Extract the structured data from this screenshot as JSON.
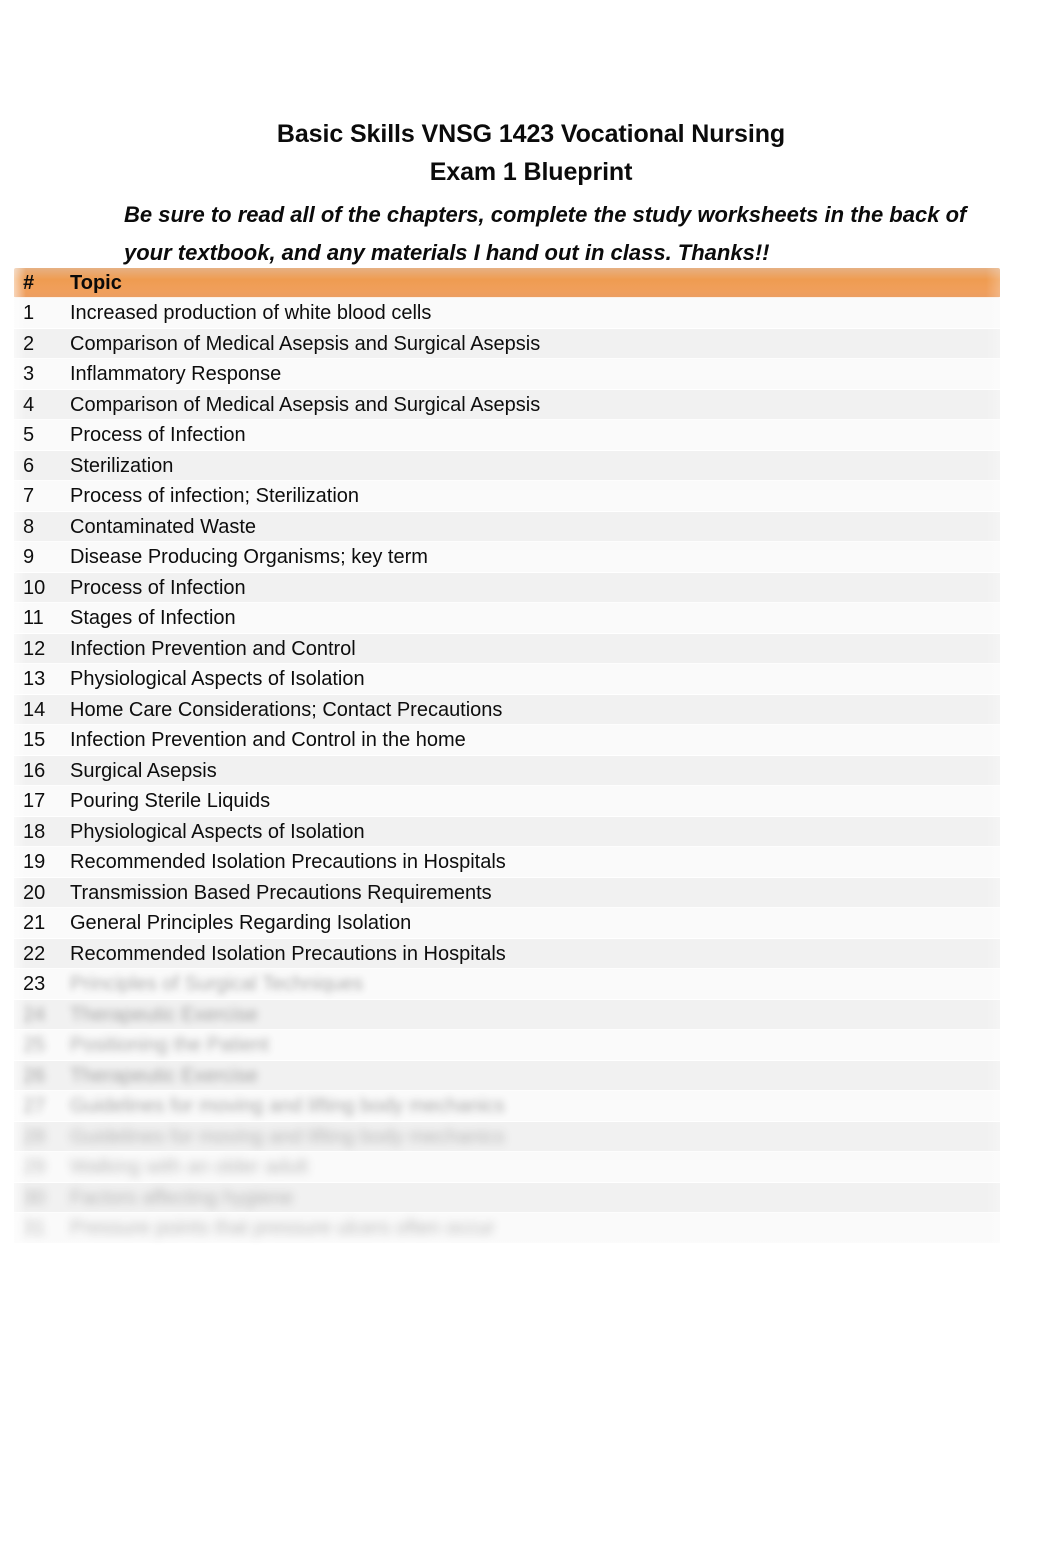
{
  "document": {
    "title_lines": [
      "Basic Skills VNSG 1423 Vocational Nursing",
      "Exam 1 Blueprint"
    ],
    "subtitle_lines": [
      "Be sure to read all of the chapters, complete the study worksheets in the back of",
      "your textbook, and any materials I hand out in class. Thanks!!"
    ]
  },
  "table": {
    "header": {
      "number_label": "#",
      "topic_label": "Topic"
    },
    "header_background_color": "#ef9c51",
    "band_color_a": "#f1f1f1",
    "band_color_b": "#fafafa",
    "rows": [
      {
        "num": "1",
        "topic": "Increased production of white blood cells"
      },
      {
        "num": "2",
        "topic": "Comparison of Medical Asepsis and Surgical Asepsis"
      },
      {
        "num": "3",
        "topic": "Inflammatory Response"
      },
      {
        "num": "4",
        "topic": "Comparison of Medical Asepsis and Surgical Asepsis"
      },
      {
        "num": "5",
        "topic": "Process of Infection"
      },
      {
        "num": "6",
        "topic": "Sterilization"
      },
      {
        "num": "7",
        "topic": "Process of infection; Sterilization"
      },
      {
        "num": "8",
        "topic": "Contaminated Waste"
      },
      {
        "num": "9",
        "topic": "Disease Producing Organisms; key term"
      },
      {
        "num": "10",
        "topic": "Process of Infection"
      },
      {
        "num": "11",
        "topic": "Stages of Infection"
      },
      {
        "num": "12",
        "topic": "Infection Prevention and Control"
      },
      {
        "num": "13",
        "topic": "Physiological Aspects of Isolation"
      },
      {
        "num": "14",
        "topic": "Home Care Considerations; Contact Precautions"
      },
      {
        "num": "15",
        "topic": "Infection Prevention and Control in the home"
      },
      {
        "num": "16",
        "topic": "Surgical Asepsis"
      },
      {
        "num": "17",
        "topic": "Pouring Sterile Liquids"
      },
      {
        "num": "18",
        "topic": "Physiological Aspects of Isolation"
      },
      {
        "num": "19",
        "topic": "Recommended Isolation Precautions in Hospitals"
      },
      {
        "num": "20",
        "topic": "Transmission Based Precautions Requirements"
      },
      {
        "num": "21",
        "topic": "General Principles Regarding Isolation"
      },
      {
        "num": "22",
        "topic": "Recommended Isolation Precautions in Hospitals"
      }
    ],
    "obscured_rows": [
      {
        "num": "23",
        "topic": "Principles of Surgical Techniques",
        "state": "topic-blurred"
      },
      {
        "num": "24",
        "topic": "Therapeutic Exercise",
        "state": "blurred"
      },
      {
        "num": "25",
        "topic": "Positioning the Patient",
        "state": "blurred"
      },
      {
        "num": "26",
        "topic": "Therapeutic Exercise",
        "state": "blurred"
      },
      {
        "num": "27",
        "topic": "Guidelines for moving and lifting body mechanics",
        "state": "blurred"
      },
      {
        "num": "28",
        "topic": "Guidelines for moving and lifting body mechanics",
        "state": "blurred"
      },
      {
        "num": "29",
        "topic": "Walking with an older adult",
        "state": "blurred"
      },
      {
        "num": "30",
        "topic": "Factors affecting hygiene",
        "state": "blurred"
      },
      {
        "num": "31",
        "topic": "Pressure points that pressure ulcers often occur",
        "state": "blurred"
      }
    ]
  }
}
